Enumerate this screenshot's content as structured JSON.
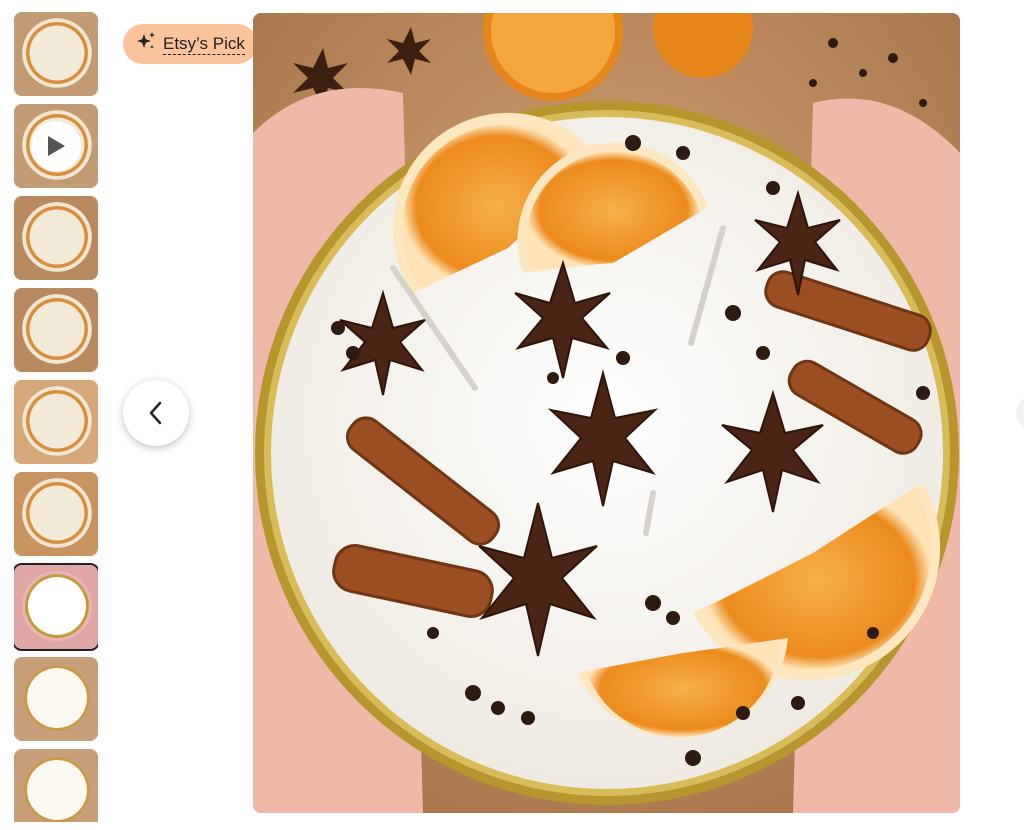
{
  "badge": {
    "label": "Etsy’s Pick",
    "icon": "sparkles-icon",
    "background": "#fbc39c"
  },
  "gallery": {
    "thumbnails": [
      {
        "kind": "image",
        "active": false
      },
      {
        "kind": "video",
        "active": false
      },
      {
        "kind": "image",
        "active": false
      },
      {
        "kind": "image",
        "active": false
      },
      {
        "kind": "image",
        "active": false
      },
      {
        "kind": "image",
        "active": false
      },
      {
        "kind": "image",
        "active": true
      },
      {
        "kind": "image",
        "active": false
      },
      {
        "kind": "image",
        "active": false
      }
    ],
    "prev_icon": "chevron-left-icon",
    "next_icon": "chevron-right-icon",
    "main_image_subject": "candle-tin-with-orange-slices-star-anise-cinnamon-cloves"
  },
  "colors": {
    "active_thumb_outline": "#222222",
    "wax": "#f6f3ee",
    "tin_rim": "#b9962f",
    "orange": "#f29a2e",
    "spice": "#4a2a18"
  }
}
